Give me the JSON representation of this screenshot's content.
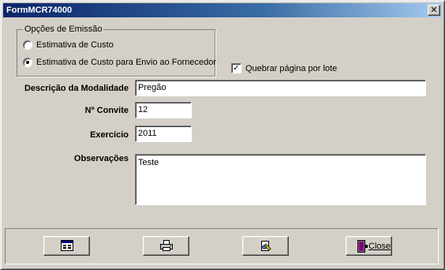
{
  "window": {
    "title": "FormMCR74000",
    "close_glyph": "✕"
  },
  "emission_options": {
    "group_title": "Opções de Emissão",
    "options": [
      {
        "label": "Estimativa de Custo",
        "checked": false
      },
      {
        "label": "Estimativa de Custo para Envio ao Fornecedor",
        "checked": true
      }
    ]
  },
  "break_page": {
    "label": "Quebrar página por lote",
    "checked": true,
    "mark": "✓"
  },
  "fields": {
    "modalidade": {
      "label": "Descrição da Modalidade",
      "value": "Pregão"
    },
    "convite": {
      "label": "Nº Convite",
      "value": "12"
    },
    "exercicio": {
      "label": "Exercício",
      "value": "2011"
    },
    "observacoes": {
      "label": "Observações",
      "value": "Teste"
    }
  },
  "toolbar": {
    "preview_icon": "preview-icon",
    "print_icon": "printer-icon",
    "export_icon": "export-icon",
    "close_icon": "exit-door-icon",
    "close_label": "Close"
  }
}
